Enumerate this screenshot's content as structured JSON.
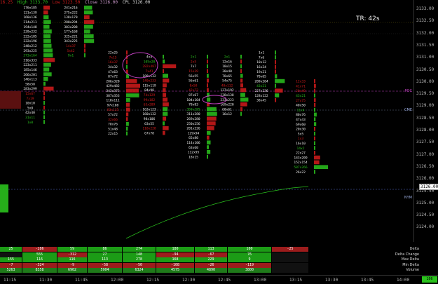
{
  "header": {
    "high_label": "High 3133.70",
    "low_label": "Low 3123.50",
    "close_label": "Close 3126.00",
    "cpl_label": "CPL 3126.00",
    "prefix": "16.25"
  },
  "tr_label": "TR: 42s",
  "levels": {
    "poc": "POC",
    "cme": "CME",
    "nym": "NYM"
  },
  "current_price": "3126.00",
  "chart_data": {
    "type": "footprint",
    "y_ticks": [
      "3133.00",
      "3132.50",
      "3132.00",
      "3131.50",
      "3131.00",
      "3130.50",
      "3130.00",
      "3129.50",
      "3129.00",
      "3128.50",
      "3128.00",
      "3127.50",
      "3127.00",
      "3126.50",
      "3126.00",
      "3125.50",
      "3125.00",
      "3124.50",
      "3124.00"
    ],
    "x_ticks": [
      "11:15",
      "11:30",
      "11:45",
      "12:00",
      "12:15",
      "12:30",
      "12:45",
      "13:00",
      "13:15",
      "13:30",
      "13:45",
      "14:00"
    ],
    "columns": [
      {
        "id": "c1",
        "rows": [
          "176x185",
          "121x139",
          "160x136",
          "214x211",
          "194x148",
          "239x232",
          "222x185",
          "232x196",
          "248x212",
          "293x225",
          "373x164",
          "316x333",
          "223x211",
          "185x146",
          "266x201",
          "146x113",
          "58x58",
          "283x299",
          "15x67",
          "7x19",
          "10x10",
          "5x8",
          "42x40",
          "31x11",
          "1x0"
        ]
      },
      {
        "id": "c2",
        "rows": [
          "241x216",
          "275x222",
          "138x170",
          "280x294",
          "303x208",
          "177x168",
          "325x221",
          "343x225",
          "14x37",
          "5x42",
          "9x1"
        ]
      },
      {
        "id": "c3",
        "rows": [
          "22x25",
          "7x15",
          "16x37",
          "34x32",
          "47x63",
          "87x72",
          "286x328",
          "429x482",
          "343x375",
          "387x353",
          "118x111",
          "97x108",
          "83x135",
          "57x72",
          "32x66",
          "78x76",
          "51x48",
          "22x15"
        ]
      },
      {
        "id": "c4",
        "rows": [
          "4x4",
          "105x20",
          "282x487",
          "7x41",
          "188x132",
          "140x233",
          "115x119",
          "84x98",
          "74x129",
          "99x182",
          "65x289",
          "163x123",
          "160x132",
          "98x106",
          "63x55",
          "118x228",
          "67x78"
        ]
      },
      {
        "id": "c5",
        "rows": [
          "2x1",
          "2x5",
          "7x7",
          "15x39",
          "56x55",
          "56x61",
          "8x58",
          "42x72",
          "87x67",
          "104x104",
          "78x83",
          "359x195",
          "311x280",
          "269x280",
          "250x256",
          "201x226",
          "129x94",
          "65x80",
          "114x106",
          "63x60",
          "112x95",
          "18x15"
        ]
      },
      {
        "id": "c6",
        "rows": [
          "2x1",
          "12x16",
          "18x15",
          "30x40",
          "78x65",
          "54x75",
          "48x112",
          "137x192",
          "138x138",
          "233x223",
          "169x220",
          "60x61",
          "16x12"
        ]
      },
      {
        "id": "c7",
        "rows": [
          "1x1",
          "7x6",
          "10x12",
          "16x24",
          "19x21",
          "70x65",
          "289x284",
          "43x21",
          "227x236",
          "128x122",
          "38x45"
        ]
      },
      {
        "id": "c8",
        "rows": [
          "12x33",
          "41x71",
          "20x40",
          "43x21",
          "27x75",
          "40x50",
          "11x4",
          "80x76",
          "47x43",
          "69x60",
          "20x30",
          "5x5",
          "1x3",
          "16x10",
          "14x2",
          "22x27",
          "143x209",
          "152x154",
          "587x266",
          "26x22"
        ]
      }
    ]
  },
  "stats": {
    "delta": [
      "25",
      "-286",
      "59",
      "86",
      "274",
      "180",
      "113",
      "100",
      "-25"
    ],
    "delta_change": [
      "",
      "555",
      "-312",
      "27",
      "148",
      "-94",
      "-67",
      "76",
      ""
    ],
    "max_delta": [
      "155",
      "116",
      "116",
      "113",
      "278",
      "168",
      "229",
      "9",
      ""
    ],
    "min_delta": [
      "-7",
      "-324",
      "-9",
      "-58",
      "-50",
      "-108",
      "-26",
      "-119",
      ""
    ],
    "volume": [
      "5263",
      "8358",
      "6902",
      "5904",
      "6324",
      "4575",
      "4890",
      "3800",
      ""
    ],
    "labels": {
      "delta": "Delta",
      "delta_change": "Delta Change",
      "max_delta": "Max Delta",
      "min_delta": "Min Delta",
      "volume": "Volume"
    }
  },
  "corner_label": "106",
  "colors": {
    "buy": "#2ac21d",
    "sell": "#d21b1b",
    "poc": "#c040c0",
    "accent": "#eee"
  }
}
